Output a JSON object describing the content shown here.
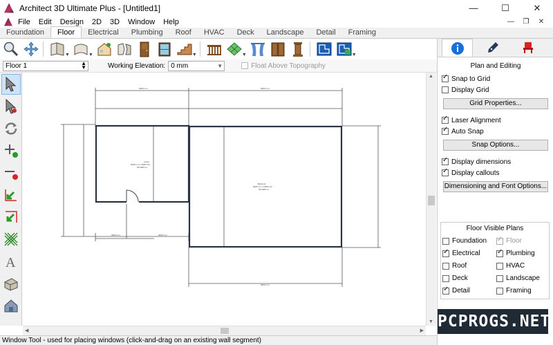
{
  "window": {
    "title": "Architect 3D Ultimate Plus - [Untitled1]",
    "minimize": "—",
    "maximize": "☐",
    "close": "✕"
  },
  "menu": {
    "items": [
      "File",
      "Edit",
      "Design",
      "2D",
      "3D",
      "Window",
      "Help"
    ],
    "mdi_min": "—",
    "mdi_restore": "❐",
    "mdi_close": "✕"
  },
  "tabs": [
    "Foundation",
    "Floor",
    "Electrical",
    "Plumbing",
    "Roof",
    "HVAC",
    "Deck",
    "Landscape",
    "Detail",
    "Framing"
  ],
  "active_tab": "Floor",
  "options": {
    "floor_value": "Floor 1",
    "elevation_label": "Working Elevation:",
    "elevation_value": "0 mm",
    "float_label": "Float Above Topography"
  },
  "right_panel": {
    "section_title": "Plan and Editing",
    "snap_to_grid": "Snap to Grid",
    "display_grid": "Display Grid",
    "grid_properties_btn": "Grid Properties...",
    "laser_alignment": "Laser Alignment",
    "auto_snap": "Auto Snap",
    "snap_options_btn": "Snap Options...",
    "display_dimensions": "Display dimensions",
    "display_callouts": "Display callouts",
    "dimensioning_btn": "Dimensioning and Font Options...",
    "visible_plans_title": "Floor Visible Plans",
    "visible_plans": [
      {
        "label": "Foundation",
        "checked": false,
        "disabled": false
      },
      {
        "label": "Floor",
        "checked": true,
        "disabled": true
      },
      {
        "label": "Electrical",
        "checked": true,
        "disabled": false
      },
      {
        "label": "Plumbing",
        "checked": true,
        "disabled": false
      },
      {
        "label": "Roof",
        "checked": false,
        "disabled": false
      },
      {
        "label": "HVAC",
        "checked": false,
        "disabled": false
      },
      {
        "label": "Deck",
        "checked": false,
        "disabled": false
      },
      {
        "label": "Landscape",
        "checked": false,
        "disabled": false
      },
      {
        "label": "Detail",
        "checked": true,
        "disabled": false
      },
      {
        "label": "Framing",
        "checked": false,
        "disabled": false
      }
    ]
  },
  "statusbar": {
    "text": "Window Tool - used for placing windows (click-and-drag on an existing wall segment)"
  },
  "watermark": "PCPROGS.NET",
  "colors": {
    "info_blue": "#1a6fd6",
    "selection_bg": "#cfe3f7",
    "wall_line": "#2a3440"
  }
}
